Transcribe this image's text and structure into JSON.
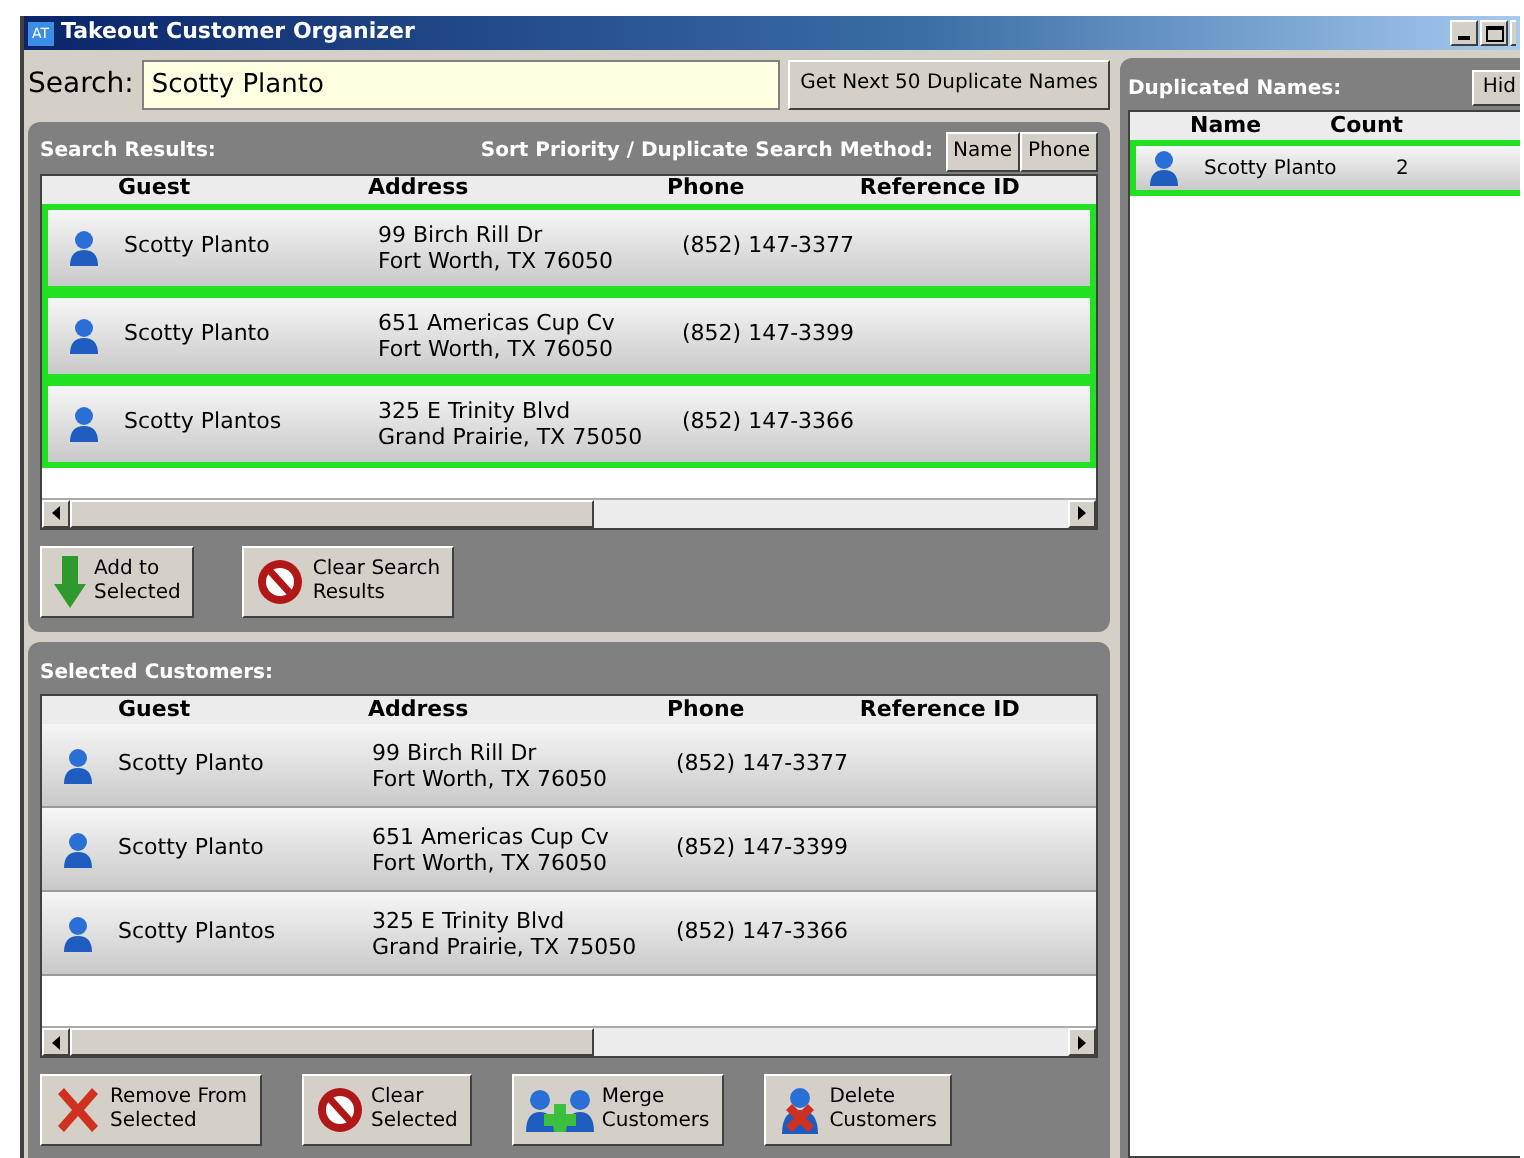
{
  "window": {
    "title": "Takeout Customer Organizer",
    "badge": "AT"
  },
  "search": {
    "label": "Search:",
    "value": "Scotty Planto",
    "next_button": "Get Next 50 Duplicate Names"
  },
  "search_results": {
    "title": "Search Results:",
    "sort_label": "Sort Priority / Duplicate Search Method:",
    "sort_buttons": [
      "Name",
      "Phone"
    ],
    "columns": [
      "Guest",
      "Address",
      "Phone",
      "Reference ID"
    ],
    "rows": [
      {
        "guest": "Scotty Planto",
        "address": [
          "99 Birch Rill Dr",
          "Fort Worth, TX 76050"
        ],
        "phone": "(852) 147-3377",
        "selected": true
      },
      {
        "guest": "Scotty Planto",
        "address": [
          "651 Americas Cup Cv",
          "Fort Worth, TX 76050"
        ],
        "phone": "(852) 147-3399",
        "selected": true
      },
      {
        "guest": "Scotty Plantos",
        "address": [
          "325 E Trinity Blvd",
          "Grand Prairie, TX 75050"
        ],
        "phone": "(852) 147-3366",
        "selected": true
      }
    ],
    "buttons": [
      {
        "kind": "add",
        "label": [
          "Add to",
          "Selected"
        ]
      },
      {
        "kind": "clear",
        "label": [
          "Clear Search",
          "Results"
        ]
      }
    ]
  },
  "selected_customers": {
    "title": "Selected Customers:",
    "columns": [
      "Guest",
      "Address",
      "Phone",
      "Reference ID"
    ],
    "rows": [
      {
        "guest": "Scotty Planto",
        "address": [
          "99 Birch Rill Dr",
          "Fort Worth, TX 76050"
        ],
        "phone": "(852) 147-3377",
        "selected": false
      },
      {
        "guest": "Scotty Planto",
        "address": [
          "651 Americas Cup Cv",
          "Fort Worth, TX 76050"
        ],
        "phone": "(852) 147-3399",
        "selected": false
      },
      {
        "guest": "Scotty Plantos",
        "address": [
          "325 E Trinity Blvd",
          "Grand Prairie, TX 75050"
        ],
        "phone": "(852) 147-3366",
        "selected": false
      }
    ],
    "buttons": [
      {
        "kind": "remove",
        "label": [
          "Remove From",
          "Selected"
        ]
      },
      {
        "kind": "clear",
        "label": [
          "Clear",
          "Selected"
        ]
      },
      {
        "kind": "merge",
        "label": [
          "Merge",
          "Customers"
        ]
      },
      {
        "kind": "delete",
        "label": [
          "Delete",
          "Customers"
        ]
      }
    ]
  },
  "duplicated_names": {
    "title": "Duplicated Names:",
    "hide_button": "Hid",
    "columns": [
      "Name",
      "Count"
    ],
    "rows": [
      {
        "name": "Scotty Planto",
        "count": "2",
        "selected": true
      }
    ]
  }
}
